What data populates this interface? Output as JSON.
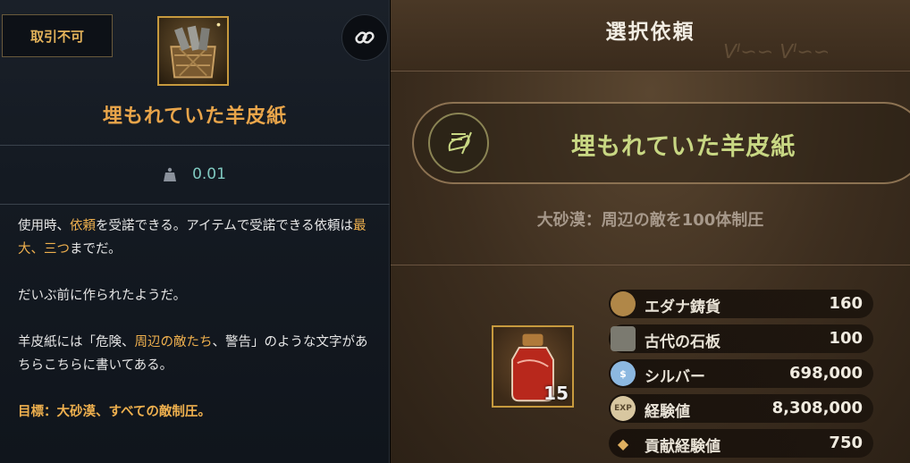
{
  "item_panel": {
    "trade_badge": "取引不可",
    "item_name": "埋もれていた羊皮紙",
    "weight": "0.01",
    "description": {
      "p1": [
        "使用時、",
        "依頼",
        "を受諾できる。アイテムで受諾できる依頼は",
        "最大、三つ",
        "までだ。"
      ],
      "p2": "だいぶ前に作られたようだ。",
      "p3": [
        "羊皮紙には「危険、",
        "周辺の敵たち",
        "、警告」のような文字があちらこちらに書いてある。"
      ],
      "goal": "目標：大砂漠、すべての敵制圧。"
    }
  },
  "request_panel": {
    "title": "選択依頼",
    "quest_name": "埋もれていた羊皮紙",
    "quest_subtitle": "大砂漠：周辺の敵を100体制圧",
    "item_count": "15",
    "rewards": [
      {
        "name": "エダナ鋳貨",
        "value": "160",
        "icon": "coin-icon",
        "color": "#c8a060"
      },
      {
        "name": "古代の石板",
        "value": "100",
        "icon": "stone-tablet-icon",
        "color": "#8a8a80"
      },
      {
        "name": "シルバー",
        "value": "698,000",
        "icon": "silver-icon",
        "color": "#9cc4e8"
      },
      {
        "name": "経験値",
        "value": "8,308,000",
        "icon": "exp-icon",
        "color": "#d9c9a0"
      },
      {
        "name": "貢献経験値",
        "value": "750",
        "icon": "contribution-icon",
        "color": "#e0b060"
      }
    ],
    "exp_icon_text": "EXP"
  }
}
